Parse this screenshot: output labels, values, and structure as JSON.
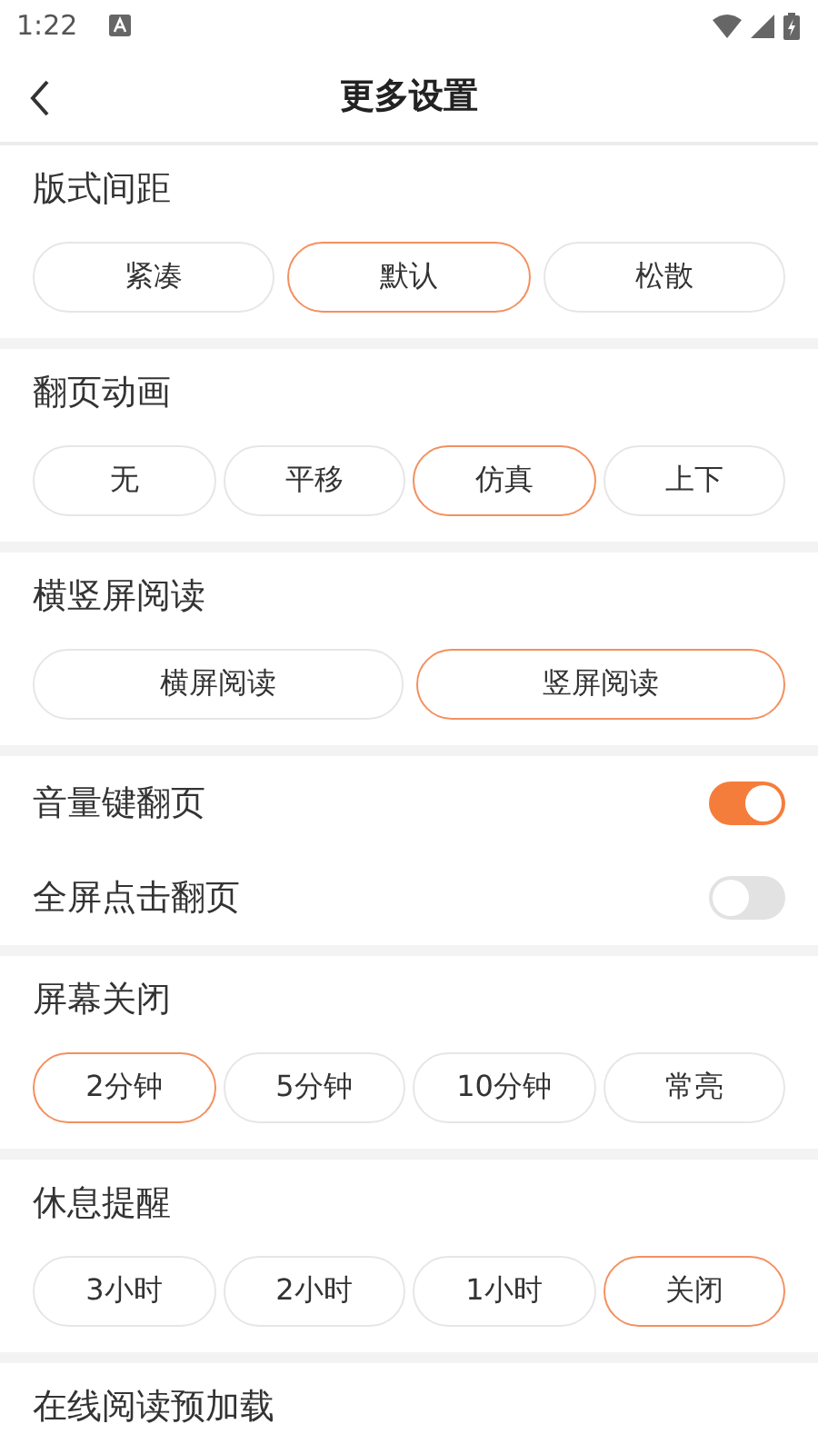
{
  "status_bar": {
    "time": "1:22"
  },
  "header": {
    "title": "更多设置"
  },
  "sections": [
    {
      "kind": "options",
      "title": "版式间距",
      "options": [
        {
          "label": "紧凑",
          "selected": false
        },
        {
          "label": "默认",
          "selected": true
        },
        {
          "label": "松散",
          "selected": false
        }
      ]
    },
    {
      "kind": "options",
      "title": "翻页动画",
      "options": [
        {
          "label": "无",
          "selected": false
        },
        {
          "label": "平移",
          "selected": false
        },
        {
          "label": "仿真",
          "selected": true
        },
        {
          "label": "上下",
          "selected": false
        }
      ]
    },
    {
      "kind": "options",
      "title": "横竖屏阅读",
      "options": [
        {
          "label": "横屏阅读",
          "selected": false
        },
        {
          "label": "竖屏阅读",
          "selected": true
        }
      ]
    },
    {
      "kind": "toggles",
      "items": [
        {
          "label": "音量键翻页",
          "on": true
        },
        {
          "label": "全屏点击翻页",
          "on": false
        }
      ]
    },
    {
      "kind": "options",
      "title": "屏幕关闭",
      "options": [
        {
          "label": "2分钟",
          "selected": true
        },
        {
          "label": "5分钟",
          "selected": false
        },
        {
          "label": "10分钟",
          "selected": false
        },
        {
          "label": "常亮",
          "selected": false
        }
      ]
    },
    {
      "kind": "options",
      "title": "休息提醒",
      "options": [
        {
          "label": "3小时",
          "selected": false
        },
        {
          "label": "2小时",
          "selected": false
        },
        {
          "label": "1小时",
          "selected": false
        },
        {
          "label": "关闭",
          "selected": true
        }
      ]
    },
    {
      "kind": "heading",
      "title": "在线阅读预加载"
    }
  ]
}
